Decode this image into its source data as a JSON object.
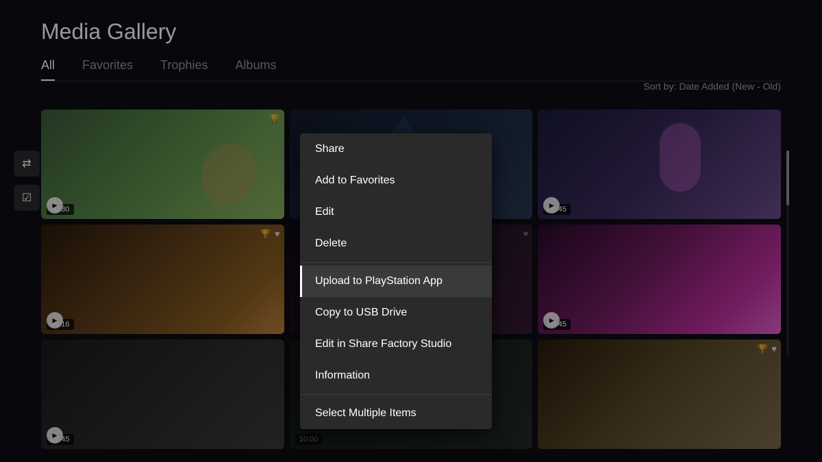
{
  "page": {
    "title": "Media Gallery",
    "sort_label": "Sort by: Date Added (New - Old)"
  },
  "tabs": [
    {
      "id": "all",
      "label": "All",
      "active": true
    },
    {
      "id": "favorites",
      "label": "Favorites",
      "active": false
    },
    {
      "id": "trophies",
      "label": "Trophies",
      "active": false
    },
    {
      "id": "albums",
      "label": "Albums",
      "active": false
    }
  ],
  "sidebar": {
    "filter_icon": "≡↓",
    "select_icon": "☑"
  },
  "gallery": {
    "thumbnails": [
      {
        "id": 1,
        "time": "00:30",
        "has_trophy": true,
        "has_heart": false,
        "col": 1,
        "row": 1
      },
      {
        "id": 2,
        "time": null,
        "has_trophy": false,
        "has_heart": false,
        "col": 2,
        "row": 1,
        "dimmed": true
      },
      {
        "id": 3,
        "time": "00:45",
        "has_trophy": false,
        "has_heart": false,
        "col": 3,
        "row": 1
      },
      {
        "id": 4,
        "time": "05:16",
        "has_trophy": true,
        "has_heart": true,
        "col": 1,
        "row": 2
      },
      {
        "id": 5,
        "time": null,
        "has_trophy": false,
        "has_heart": true,
        "col": 2,
        "row": 2,
        "dimmed": true
      },
      {
        "id": 6,
        "time": "00:45",
        "has_trophy": false,
        "has_heart": false,
        "col": 3,
        "row": 2
      },
      {
        "id": 7,
        "time": "07:45",
        "has_trophy": false,
        "has_heart": false,
        "col": 1,
        "row": 3
      },
      {
        "id": 8,
        "time": "10:00",
        "has_trophy": false,
        "has_heart": false,
        "col": 2,
        "row": 3,
        "dimmed": true
      },
      {
        "id": 9,
        "time": null,
        "has_trophy": true,
        "has_heart": true,
        "col": 3,
        "row": 3
      }
    ]
  },
  "context_menu": {
    "items": [
      {
        "id": "share",
        "label": "Share",
        "highlighted": false,
        "divider_after": false
      },
      {
        "id": "add-favorites",
        "label": "Add to Favorites",
        "highlighted": false,
        "divider_after": false
      },
      {
        "id": "edit",
        "label": "Edit",
        "highlighted": false,
        "divider_after": false
      },
      {
        "id": "delete",
        "label": "Delete",
        "highlighted": false,
        "divider_after": true
      },
      {
        "id": "upload-ps-app",
        "label": "Upload to PlayStation App",
        "highlighted": true,
        "divider_after": false
      },
      {
        "id": "copy-usb",
        "label": "Copy to USB Drive",
        "highlighted": false,
        "divider_after": false
      },
      {
        "id": "share-factory",
        "label": "Edit in Share Factory Studio",
        "highlighted": false,
        "divider_after": false
      },
      {
        "id": "information",
        "label": "Information",
        "highlighted": false,
        "divider_after": true
      },
      {
        "id": "select-multiple",
        "label": "Select Multiple Items",
        "highlighted": false,
        "divider_after": false
      }
    ]
  }
}
